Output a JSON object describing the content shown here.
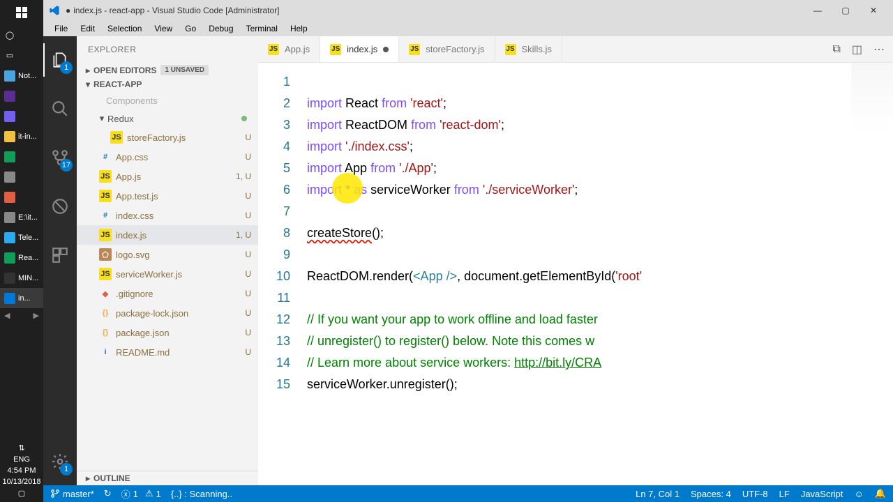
{
  "taskbar": {
    "items": [
      {
        "label": "Not...",
        "color": "#4aa3df"
      },
      {
        "label": "",
        "color": "#5c2d91"
      },
      {
        "label": "",
        "color": "#7360f2"
      },
      {
        "label": "it-in...",
        "color": "#f0c040"
      },
      {
        "label": "",
        "color": "#0f9d58"
      },
      {
        "label": "",
        "color": "#888"
      },
      {
        "label": "",
        "color": "#e25d43"
      },
      {
        "label": "E:\\it...",
        "color": "#888"
      },
      {
        "label": "Tele...",
        "color": "#2aabee"
      },
      {
        "label": "Rea...",
        "color": "#0f9d58"
      },
      {
        "label": "MIN...",
        "color": "#333"
      },
      {
        "label": "in...",
        "color": "#0078d7"
      }
    ],
    "tray": {
      "lang": "ENG",
      "time": "4:54 PM",
      "date": "10/13/2018"
    }
  },
  "title": "index.js - react-app - Visual Studio Code [Administrator]",
  "title_dirty_dot": "●",
  "menu": [
    "File",
    "Edit",
    "Selection",
    "View",
    "Go",
    "Debug",
    "Terminal",
    "Help"
  ],
  "activity_badges": {
    "explorer": "1",
    "scm": "17",
    "settings": "1"
  },
  "sidebar": {
    "title": "EXPLORER",
    "open_editors": "OPEN EDITORS",
    "unsaved": "1 UNSAVED",
    "project": "REACT-APP",
    "folders": {
      "components": "Components",
      "redux": "Redux"
    },
    "files": [
      {
        "name": "storeFactory.js",
        "icon": "JS",
        "status": "U",
        "indent": "sub"
      },
      {
        "name": "App.css",
        "icon": "#",
        "status": "U"
      },
      {
        "name": "App.js",
        "icon": "JS",
        "status": "1, U"
      },
      {
        "name": "App.test.js",
        "icon": "JS",
        "status": "U"
      },
      {
        "name": "index.css",
        "icon": "#",
        "status": "U"
      },
      {
        "name": "index.js",
        "icon": "JS",
        "status": "1, U",
        "active": true
      },
      {
        "name": "logo.svg",
        "icon": "SVG",
        "status": "U"
      },
      {
        "name": "serviceWorker.js",
        "icon": "JS",
        "status": "U"
      },
      {
        "name": ".gitignore",
        "icon": "GIT",
        "status": "U"
      },
      {
        "name": "package-lock.json",
        "icon": "{}",
        "status": "U"
      },
      {
        "name": "package.json",
        "icon": "{}",
        "status": "U"
      },
      {
        "name": "README.md",
        "icon": "i",
        "status": "U"
      }
    ],
    "outline": "OUTLINE"
  },
  "tabs": [
    {
      "label": "App.js",
      "icon": "JS"
    },
    {
      "label": "index.js",
      "icon": "JS",
      "active": true,
      "dirty": true
    },
    {
      "label": "storeFactory.js",
      "icon": "JS"
    },
    {
      "label": "Skills.js",
      "icon": "JS"
    }
  ],
  "code": {
    "lines": [
      "1",
      "2",
      "3",
      "4",
      "5",
      "6",
      "7",
      "8",
      "9",
      "10",
      "11",
      "12",
      "13",
      "14",
      "15"
    ],
    "l1": {
      "import": "import",
      "react": "React",
      "from": "from",
      "str": "'react'"
    },
    "l2": {
      "import": "import",
      "id": "ReactDOM",
      "from": "from",
      "str": "'react-dom'"
    },
    "l3": {
      "import": "import",
      "str": "'./index.css'"
    },
    "l4": {
      "import": "import",
      "id": "App",
      "from": "from",
      "str": "'./App'"
    },
    "l5": {
      "import": "import",
      "star": "*",
      "as": "as",
      "id": "serviceWorker",
      "from": "from",
      "str": "'./serviceWorker'"
    },
    "l7": {
      "call": "createStore",
      "rest": "();"
    },
    "l9": {
      "a": "ReactDOM.render(",
      "tag": "<App />",
      "b": ", document.getElementById(",
      "str": "'root'"
    },
    "l11": "// If you want your app to work offline and load faster",
    "l12": "// unregister() to register() below. Note this comes w",
    "l13a": "// Learn more about service workers: ",
    "l13b": "http://bit.ly/CRA",
    "l14": "serviceWorker.unregister();"
  },
  "status": {
    "branch": "master*",
    "sync": "↻",
    "errors": "1",
    "warnings": "1",
    "scanning": "{..} : Scanning..",
    "lncol": "Ln 7, Col 1",
    "spaces": "Spaces: 4",
    "encoding": "UTF-8",
    "eol": "LF",
    "lang": "JavaScript"
  }
}
